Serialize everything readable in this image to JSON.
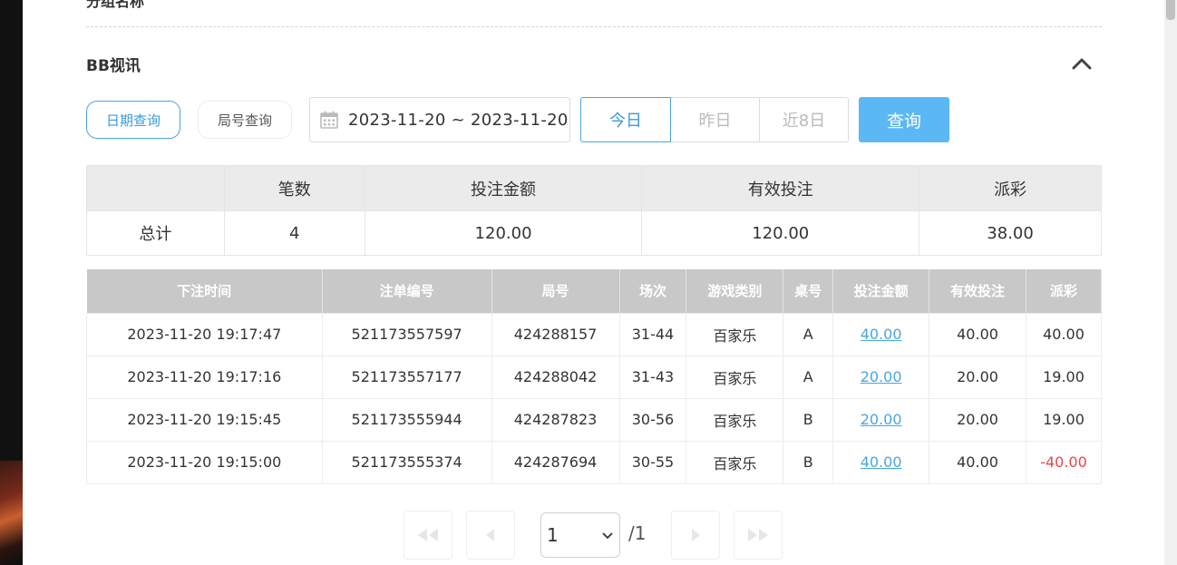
{
  "section": {
    "top_partial": "分组名称",
    "title": "BB视讯"
  },
  "filters": {
    "mode_date": "日期查询",
    "mode_round": "局号查询",
    "date_range": "2023-11-20 ~ 2023-11-20",
    "quick": [
      "今日",
      "昨日",
      "近8日"
    ],
    "search": "查询"
  },
  "summary": {
    "headers": [
      "",
      "笔数",
      "投注金额",
      "有效投注",
      "派彩"
    ],
    "row": [
      "总计",
      "4",
      "120.00",
      "120.00",
      "38.00"
    ]
  },
  "detail": {
    "headers": [
      "下注时间",
      "注单编号",
      "局号",
      "场次",
      "游戏类别",
      "桌号",
      "投注金额",
      "有效投注",
      "派彩"
    ],
    "rows": [
      [
        "2023-11-20 19:17:47",
        "521173557597",
        "424288157",
        "31-44",
        "百家乐",
        "A",
        "40.00",
        "40.00",
        "40.00"
      ],
      [
        "2023-11-20 19:17:16",
        "521173557177",
        "424288042",
        "31-43",
        "百家乐",
        "A",
        "20.00",
        "20.00",
        "19.00"
      ],
      [
        "2023-11-20 19:15:45",
        "521173555944",
        "424287823",
        "30-56",
        "百家乐",
        "B",
        "20.00",
        "20.00",
        "19.00"
      ],
      [
        "2023-11-20 19:15:00",
        "521173555374",
        "424287694",
        "30-55",
        "百家乐",
        "B",
        "40.00",
        "40.00",
        "-40.00"
      ]
    ]
  },
  "pagination": {
    "current": "1",
    "total": "/1"
  },
  "colors": {
    "accent": "#4aa6de",
    "button": "#5bb8f5",
    "negative": "#e8454a",
    "header_gray": "#c8c8c8"
  }
}
